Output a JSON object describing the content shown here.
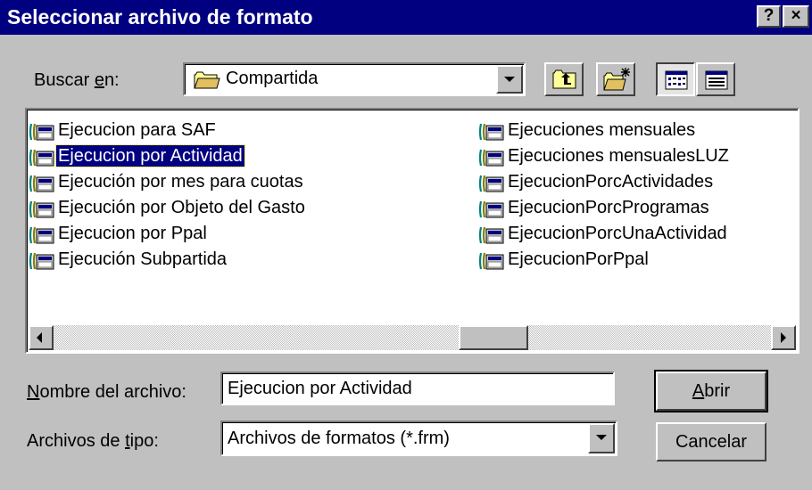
{
  "window": {
    "title": "Seleccionar archivo de formato",
    "help_label": "?",
    "close_label": "×"
  },
  "lookin": {
    "label_pre": "Buscar ",
    "label_key": "e",
    "label_post": "n:",
    "value": "Compartida",
    "icon": "folder-icon"
  },
  "toolbar": {
    "buttons": [
      {
        "name": "up-one-level-icon"
      },
      {
        "name": "new-folder-icon"
      },
      {
        "name": "list-view-icon",
        "pressed": true
      },
      {
        "name": "details-view-icon",
        "pressed": false
      }
    ]
  },
  "files": {
    "icon": "form-file-icon",
    "items": [
      {
        "label": "Ejecucion para SAF",
        "selected": false
      },
      {
        "label": "Ejecucion por Actividad",
        "selected": true
      },
      {
        "label": "Ejecución por mes para cuotas",
        "selected": false
      },
      {
        "label": "Ejecución por Objeto del Gasto",
        "selected": false
      },
      {
        "label": "Ejecucion por Ppal",
        "selected": false
      },
      {
        "label": "Ejecución Subpartida",
        "selected": false
      },
      {
        "label": "Ejecuciones mensuales",
        "selected": false
      },
      {
        "label": "Ejecuciones mensualesLUZ",
        "selected": false
      },
      {
        "label": "EjecucionPorcActividades",
        "selected": false
      },
      {
        "label": "EjecucionPorcProgramas",
        "selected": false
      },
      {
        "label": "EjecucionPorcUnaActividad",
        "selected": false
      },
      {
        "label": "EjecucionPorPpal",
        "selected": false
      }
    ]
  },
  "filename": {
    "label_key": "N",
    "label_post": "ombre del archivo:",
    "value": "Ejecucion por Actividad"
  },
  "filetype": {
    "label_pre": "Archivos de ",
    "label_key": "t",
    "label_post": "ipo:",
    "value": "Archivos de formatos (*.frm)"
  },
  "buttons": {
    "open_key": "A",
    "open_post": "brir",
    "cancel": "Cancelar"
  },
  "colors": {
    "title_bar": "#000080",
    "face": "#c0c0c0",
    "selection": "#000080"
  }
}
